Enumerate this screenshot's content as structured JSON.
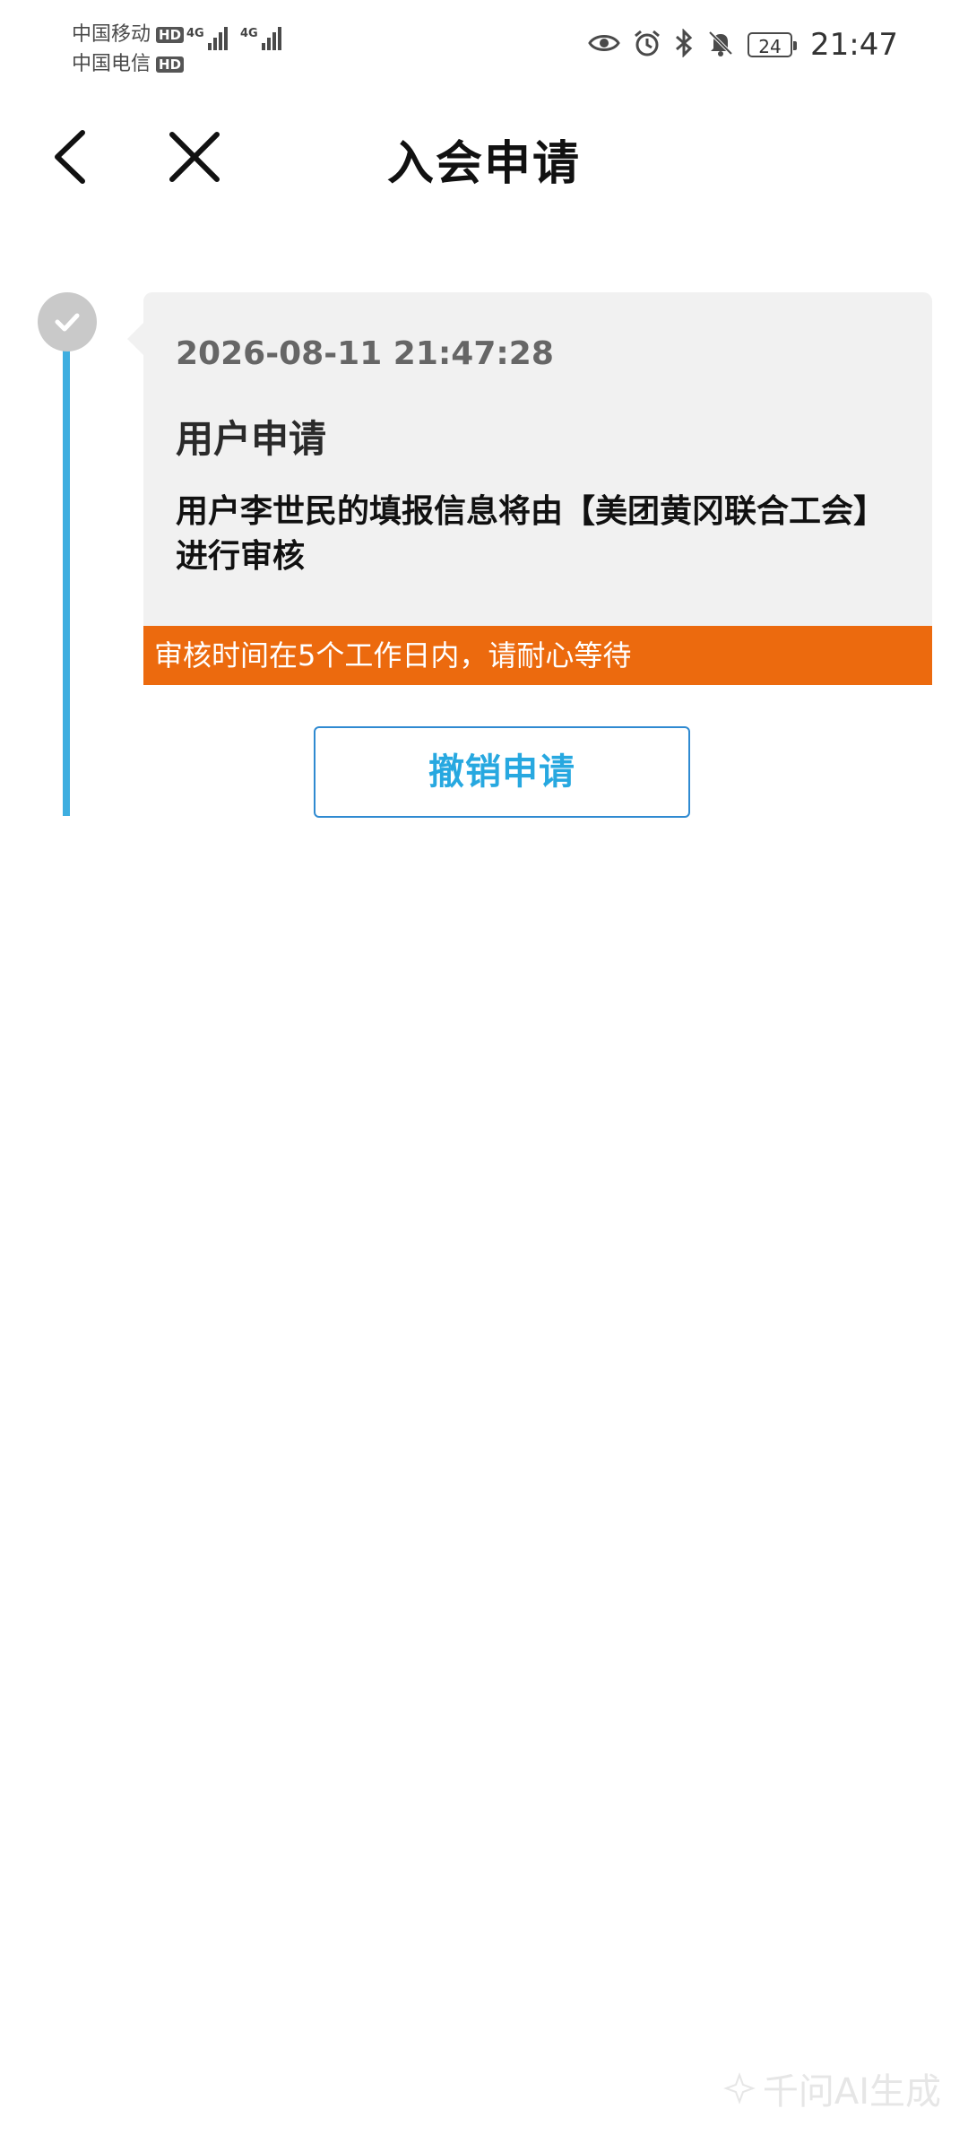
{
  "status_bar": {
    "carrier1": "中国移动",
    "carrier2": "中国电信",
    "hd_label": "HD",
    "network_label": "4G",
    "battery_level": "24",
    "time": "21:47",
    "icons": [
      "eye-icon",
      "alarm-icon",
      "bluetooth-icon",
      "bell-muted-icon",
      "battery-icon"
    ]
  },
  "header": {
    "title": "入会申请",
    "back_icon": "chevron-left-icon",
    "close_icon": "close-icon"
  },
  "timeline": {
    "node_icon": "check-icon",
    "accent_color": "#3eaee0",
    "items": [
      {
        "timestamp": "2026-08-11 21:47:28",
        "heading": "用户申请",
        "description": "用户李世民的填报信息将由【美团黄冈联合工会】进行审核",
        "notice": "审核时间在5个工作日内，请耐心等待",
        "notice_color": "#ec6a0e"
      }
    ]
  },
  "actions": {
    "revoke_label": "撤销申请",
    "revoke_color": "#27a8e0"
  },
  "watermark": {
    "text": "千问AI生成"
  }
}
